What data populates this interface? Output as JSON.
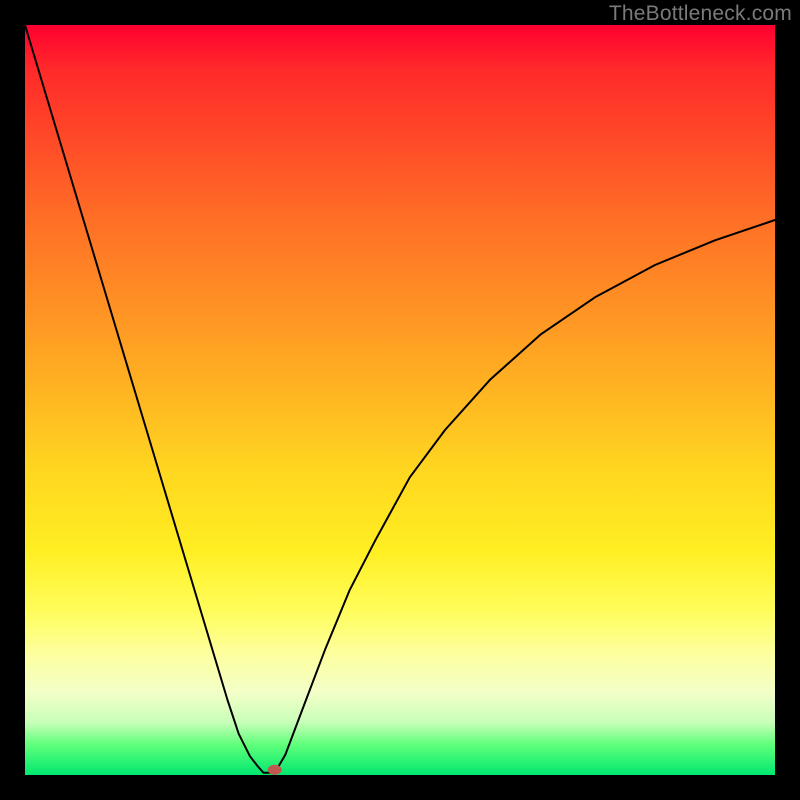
{
  "watermark": "TheBottleneck.com",
  "chart_data": {
    "type": "line",
    "title": "",
    "xlabel": "",
    "ylabel": "",
    "xlim": [
      0,
      100
    ],
    "ylim": [
      0,
      100
    ],
    "grid": false,
    "legend": false,
    "background_gradient": {
      "direction": "vertical",
      "stops": [
        {
          "pos": 0.0,
          "color": "#ff0030"
        },
        {
          "pos": 0.5,
          "color": "#ffb822"
        },
        {
          "pos": 0.78,
          "color": "#fffd5a"
        },
        {
          "pos": 0.93,
          "color": "#c8ffb8"
        },
        {
          "pos": 1.0,
          "color": "#00e86f"
        }
      ]
    },
    "series": [
      {
        "name": "left-branch",
        "x": [
          0,
          3,
          6,
          9,
          12,
          15,
          18,
          21,
          24,
          27,
          28.5,
          30,
          31,
          31.8
        ],
        "values": [
          100,
          90,
          80,
          70,
          60,
          50,
          40,
          30,
          20,
          10,
          5.5,
          2.5,
          1.2,
          0.3
        ]
      },
      {
        "name": "flat-segment",
        "x": [
          31.8,
          33.3
        ],
        "values": [
          0.3,
          0.3
        ]
      },
      {
        "name": "right-branch",
        "x": [
          33.3,
          34.7,
          36.7,
          40.0,
          43.3,
          46.7,
          51.3,
          56.0,
          62.0,
          68.7,
          76.0,
          84.0,
          92.0,
          100.0
        ],
        "values": [
          0.3,
          2.7,
          8.0,
          16.7,
          24.7,
          31.3,
          39.7,
          46.0,
          52.7,
          58.7,
          63.7,
          68.0,
          71.3,
          74.0
        ]
      }
    ],
    "marker": {
      "x": 33.3,
      "y": 0.7,
      "color": "#c05a50"
    },
    "annotations": []
  }
}
